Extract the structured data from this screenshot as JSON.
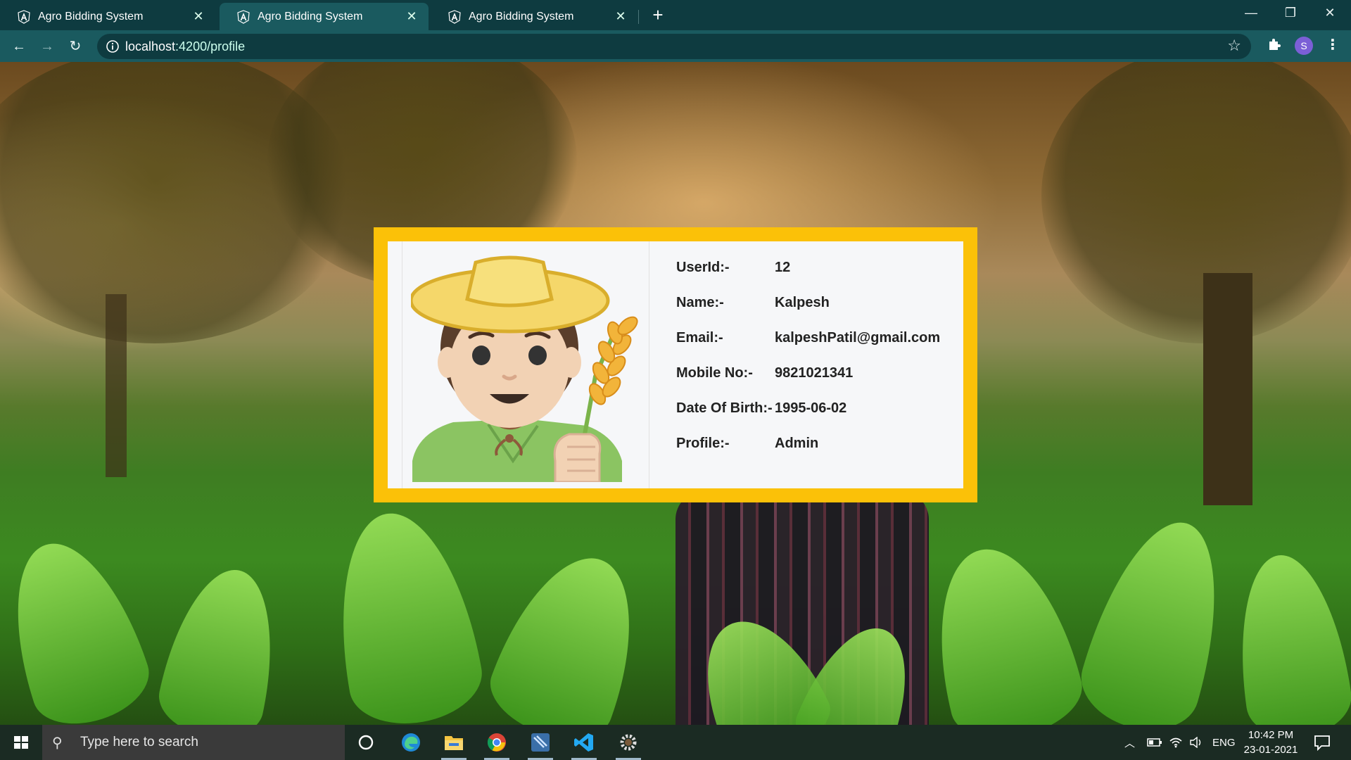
{
  "browser": {
    "tabs": [
      {
        "title": "Agro Bidding System",
        "active": false
      },
      {
        "title": "Agro Bidding System",
        "active": true
      },
      {
        "title": "Agro Bidding System",
        "active": false
      }
    ],
    "url_host": "localhost",
    "url_path": ":4200/profile",
    "profile_initial": "S",
    "colors": {
      "chrome_dark": "#0e3b40",
      "chrome_light": "#1a5a5f"
    }
  },
  "profile": {
    "fields": [
      {
        "label": "UserId:-",
        "value": "12"
      },
      {
        "label": "Name:-",
        "value": "Kalpesh"
      },
      {
        "label": "Email:-",
        "value": "kalpeshPatil@gmail.com"
      },
      {
        "label": "Mobile No:-",
        "value": "9821021341"
      },
      {
        "label": "Date Of Birth:-",
        "value": "1995-06-02"
      },
      {
        "label": "Profile:-",
        "value": "Admin"
      }
    ],
    "avatar_icon": "farmer-emoji-icon",
    "colors": {
      "frame": "#fbc108",
      "panel": "#f6f7f9"
    }
  },
  "taskbar": {
    "search_placeholder": "Type here to search",
    "language": "ENG",
    "time": "10:42 PM",
    "date": "23-01-2021",
    "pinned": [
      "cortana-icon",
      "edge-icon",
      "file-explorer-icon",
      "chrome-icon",
      "app-icon",
      "vscode-icon",
      "settings-icon"
    ]
  }
}
